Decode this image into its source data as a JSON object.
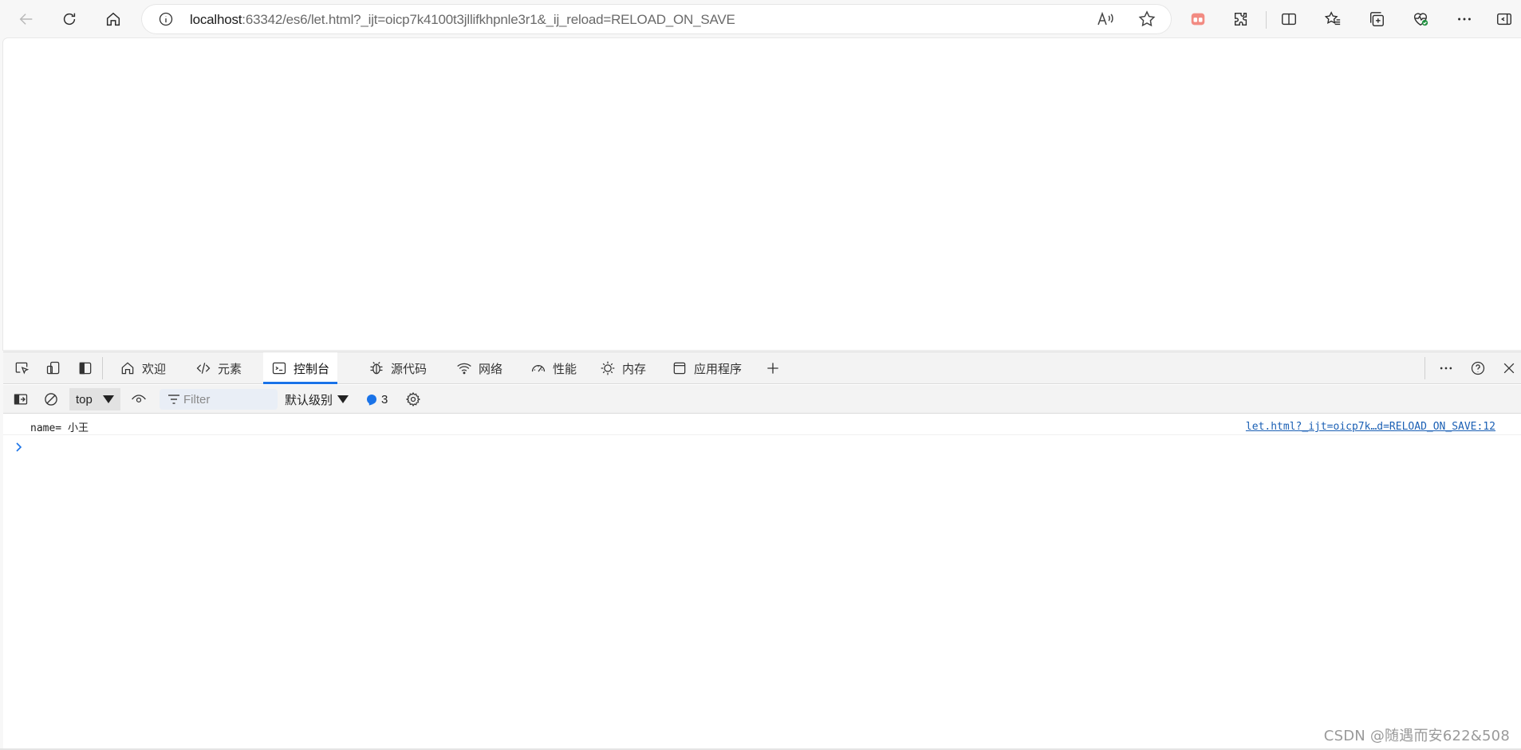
{
  "browser": {
    "url_host": "localhost",
    "url_rest": ":63342/es6/let.html?_ijt=oicp7k4100t3jllifkhpnle3r1&_ij_reload=RELOAD_ON_SAVE"
  },
  "devtools": {
    "tabs": [
      {
        "label": "欢迎",
        "icon": "home-icon"
      },
      {
        "label": "元素",
        "icon": "code-icon"
      },
      {
        "label": "控制台",
        "icon": "console-icon",
        "active": true
      },
      {
        "label": "源代码",
        "icon": "bug-icon"
      },
      {
        "label": "网络",
        "icon": "wifi-icon"
      },
      {
        "label": "性能",
        "icon": "gauge-icon"
      },
      {
        "label": "内存",
        "icon": "chip-icon"
      },
      {
        "label": "应用程序",
        "icon": "application-icon"
      }
    ],
    "console": {
      "context": "top",
      "filter_placeholder": "Filter",
      "level": "默认级别",
      "issues_count": "3",
      "messages": [
        {
          "text": "name= 小王",
          "source": "let.html?_ijt=oicp7k…d=RELOAD_ON_SAVE:12"
        }
      ]
    }
  },
  "watermark": "CSDN @随遇而安622&508",
  "colors": {
    "accent": "#1a73e8",
    "link": "#1a5fb4"
  }
}
